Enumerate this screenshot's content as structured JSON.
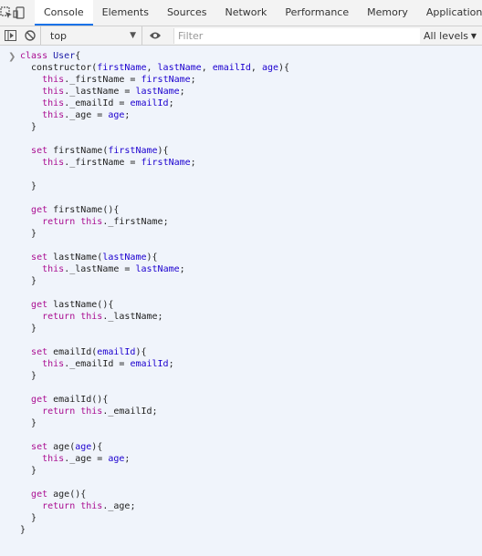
{
  "tabs": [
    "Console",
    "Elements",
    "Sources",
    "Network",
    "Performance",
    "Memory",
    "Application"
  ],
  "toolbar": {
    "context": "top",
    "filter_placeholder": "Filter",
    "levels": "All levels"
  },
  "code_lines": [
    "class User{",
    "  constructor(firstName, lastName, emailId, age){",
    "    this._firstName = firstName;",
    "    this._lastName = lastName;",
    "    this._emailId = emailId;",
    "    this._age = age;",
    "  }",
    "",
    "  set firstName(firstName){",
    "    this._firstName = firstName;",
    "",
    "  }",
    "",
    "  get firstName(){",
    "    return this._firstName;",
    "  }",
    "",
    "  set lastName(lastName){",
    "    this._lastName = lastName;",
    "  }",
    "",
    "  get lastName(){",
    "    return this._lastName;",
    "  }",
    "",
    "  set emailId(emailId){",
    "    this._emailId = emailId;",
    "  }",
    "",
    "  get emailId(){",
    "    return this._emailId;",
    "  }",
    "",
    "  set age(age){",
    "    this._age = age;",
    "  }",
    "",
    "  get age(){",
    "    return this._age;",
    "  }",
    "}"
  ]
}
